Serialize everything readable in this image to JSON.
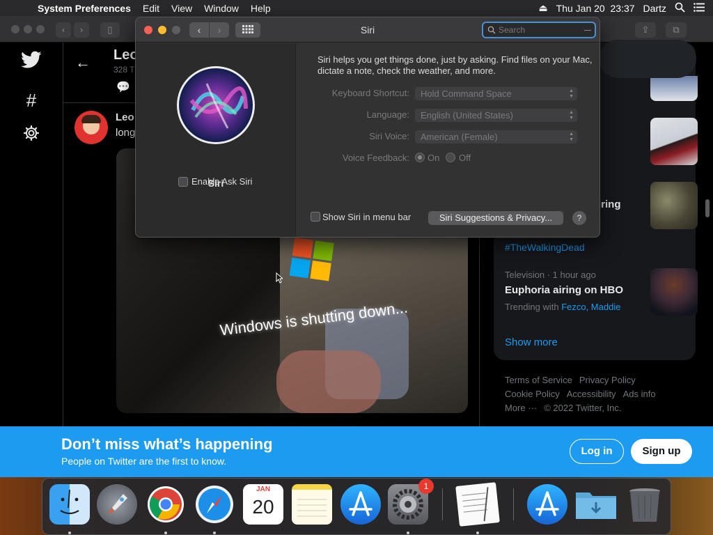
{
  "menubar": {
    "app_name": "System Preferences",
    "menus": [
      "Edit",
      "View",
      "Window",
      "Help"
    ],
    "clock": "Thu Jan 20  23:37",
    "user": "Dartz"
  },
  "twitter": {
    "profile_name": "Leo",
    "profile_sub": "328 T",
    "tweet_author": "Leo",
    "tweet_text": "long",
    "photo_caption": "Windows is shutting down...",
    "trend_hashtag": "#TheWalkingDead",
    "trend_partial": "iring",
    "trend2_meta": "Television · 1 hour ago",
    "trend2_title": "Euphoria airing on HBO",
    "trend2_with_label": "Trending with",
    "trend2_with_links": "Fezco, Maddie",
    "show_more": "Show more",
    "footer_links": [
      "Terms of Service",
      "Privacy Policy",
      "Cookie Policy",
      "Accessibility",
      "Ads info",
      "More ···",
      "© 2022 Twitter, Inc."
    ]
  },
  "banner": {
    "headline": "Don’t miss what’s happening",
    "subline": "People on Twitter are the first to know.",
    "login": "Log in",
    "signup": "Sign up"
  },
  "siri_window": {
    "title": "Siri",
    "search_placeholder": "Search",
    "pane_label": "Siri",
    "enable_label": "Enable Ask Siri",
    "description": "Siri helps you get things done, just by asking. Find files on your Mac, dictate a note, check the weather, and more.",
    "keyboard_shortcut_label": "Keyboard Shortcut:",
    "keyboard_shortcut_value": "Hold Command Space",
    "language_label": "Language:",
    "language_value": "English (United States)",
    "voice_label": "Siri Voice:",
    "voice_value": "American (Female)",
    "feedback_label": "Voice Feedback:",
    "feedback_on": "On",
    "feedback_off": "Off",
    "menu_bar_label": "Show Siri in menu bar",
    "suggestions_button": "Siri Suggestions & Privacy...",
    "help": "?"
  },
  "dock": {
    "calendar_month": "JAN",
    "calendar_day": "20",
    "system_prefs_badge": "1",
    "items": [
      "finder-icon",
      "launchpad-icon",
      "chrome-icon",
      "safari-icon",
      "calendar-icon",
      "notes-icon",
      "app-store-icon",
      "system-preferences-icon",
      "textedit-icon",
      "app-store-2-icon",
      "downloads-folder-icon",
      "trash-icon"
    ]
  }
}
